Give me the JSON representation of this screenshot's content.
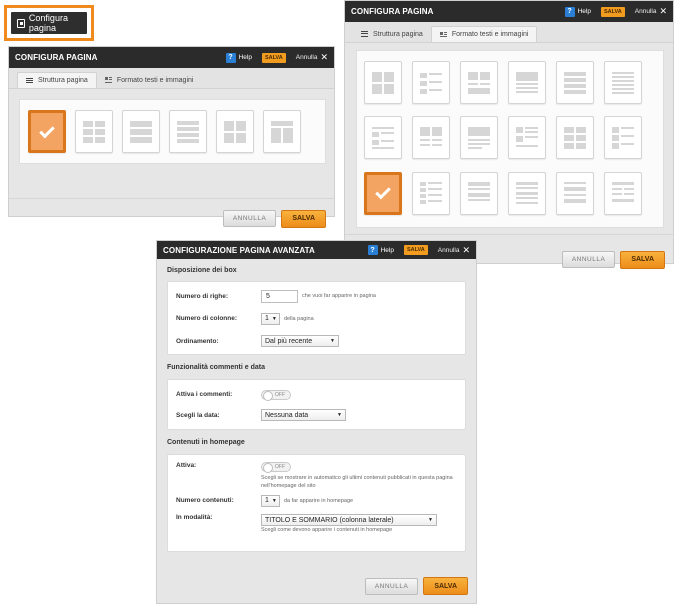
{
  "trigger": {
    "label": "Configura pagina"
  },
  "dialog_simple": {
    "title": "CONFIGURA PAGINA",
    "help": "Help",
    "salva_badge": "SALVA",
    "annulla": "Annulla",
    "tabs": [
      {
        "label": "Struttura pagina"
      },
      {
        "label": "Formato testi e immagini"
      }
    ],
    "footer": {
      "annulla": "ANNULLA",
      "salva": "SALVA"
    }
  },
  "dialog_formato": {
    "title": "CONFIGURA PAGINA",
    "help": "Help",
    "salva_badge": "SALVA",
    "annulla": "Annulla",
    "tabs": [
      {
        "label": "Struttura pagina"
      },
      {
        "label": "Formato testi e immagini"
      }
    ],
    "footer": {
      "annulla": "ANNULLA",
      "salva": "SALVA"
    }
  },
  "dialog_advanced": {
    "title": "CONFIGURAZIONE PAGINA AVANZATA",
    "help": "Help",
    "salva_badge": "SALVA",
    "annulla": "Annulla",
    "sections": {
      "disposizione": {
        "title": "Disposizione dei box",
        "righe_label": "Numero di righe:",
        "righe_value": "5",
        "righe_hint": "che vuoi far apparire in pagina",
        "colonne_label": "Numero di colonne:",
        "colonne_value": "1",
        "colonne_hint": "della pagina",
        "ordinamento_label": "Ordinamento:",
        "ordinamento_value": "Dal più recente"
      },
      "commenti": {
        "title": "Funzionalità commenti e data",
        "attiva_label": "Attiva i commenti:",
        "attiva_state": "OFF",
        "data_label": "Scegli la data:",
        "data_value": "Nessuna data"
      },
      "homepage": {
        "title": "Contenuti in homepage",
        "attiva_label": "Attiva:",
        "attiva_state": "OFF",
        "attiva_note": "Scegli se mostrare in automatico gli ultimi contenuti pubblicati in questa pagina nell'homepage del sito",
        "numero_label": "Numero contenuti:",
        "numero_value": "1",
        "numero_hint": "da far apparire in homepage",
        "modalita_label": "In modalità:",
        "modalita_value": "TITOLO E SOMMARIO (colonna laterale)",
        "modalita_note": "Scegli come devono apparire i contenuti in homepage"
      }
    },
    "footer": {
      "annulla": "ANNULLA",
      "salva": "SALVA"
    }
  },
  "colors": {
    "accent": "#f29c1f",
    "header_bg": "#2b2b2b",
    "help_blue": "#2a7fd4"
  }
}
